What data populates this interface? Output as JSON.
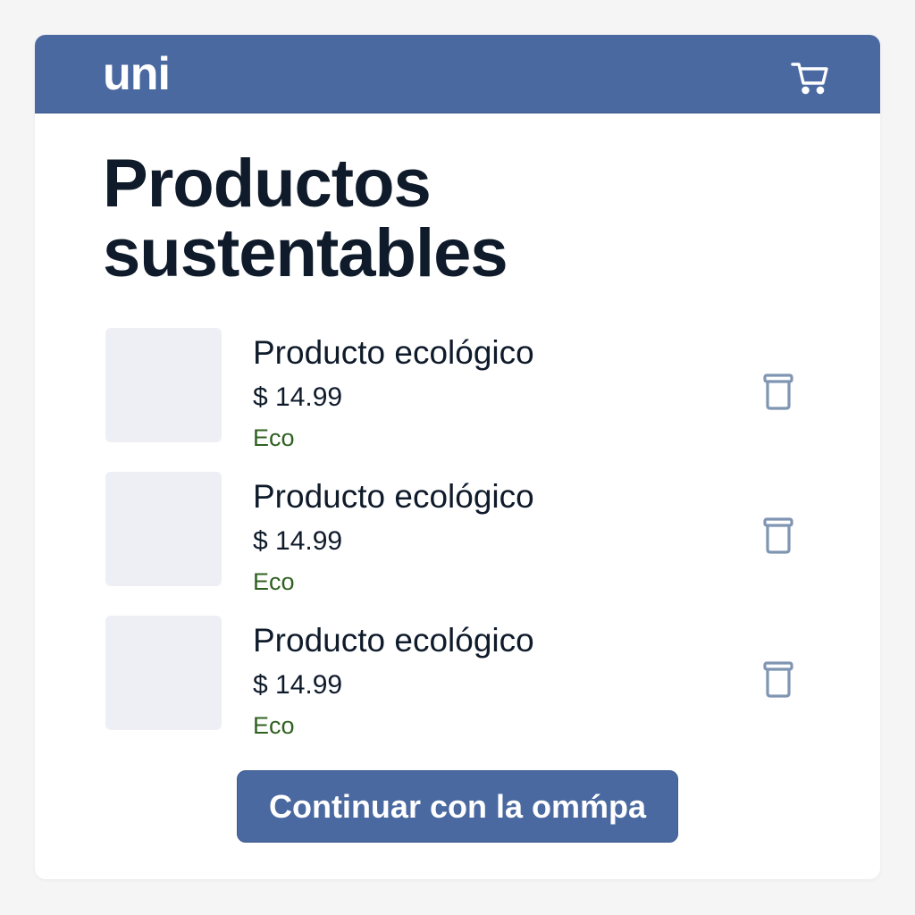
{
  "header": {
    "logo": "uni",
    "cart_icon": "shopping-cart-icon"
  },
  "page": {
    "title_line1": "Productos",
    "title_line2": "sustentables"
  },
  "items": [
    {
      "name": "Producto ecológico",
      "price": "$ 14.99",
      "tag": "Eco",
      "delete_icon": "trash-icon"
    },
    {
      "name": "Producto ecológico",
      "price": "$ 14.99",
      "tag": "Eco",
      "delete_icon": "trash-icon"
    },
    {
      "name": "Producto ecológico",
      "price": "$ 14.99",
      "tag": "Eco",
      "delete_icon": "trash-icon"
    }
  ],
  "checkout": {
    "label": "Continuar con la omḿpa"
  },
  "colors": {
    "brand": "#4a69a0",
    "text": "#0f1b2b",
    "eco_tag": "#2f6121",
    "icon": "#7f95b2",
    "thumb": "#eeeff4"
  }
}
